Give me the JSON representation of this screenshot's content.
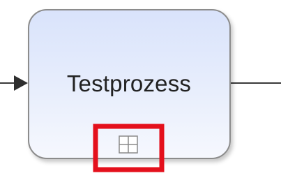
{
  "diagram": {
    "task": {
      "label": "Testprozess",
      "marker_icon": "subprocess-expand-icon"
    },
    "colors": {
      "task_fill_top": "#dbe4fb",
      "task_fill_bottom": "#f4f7fe",
      "task_border": "#8a8a8a",
      "connector": "#3a3a3a",
      "highlight": "#e4101c"
    }
  }
}
